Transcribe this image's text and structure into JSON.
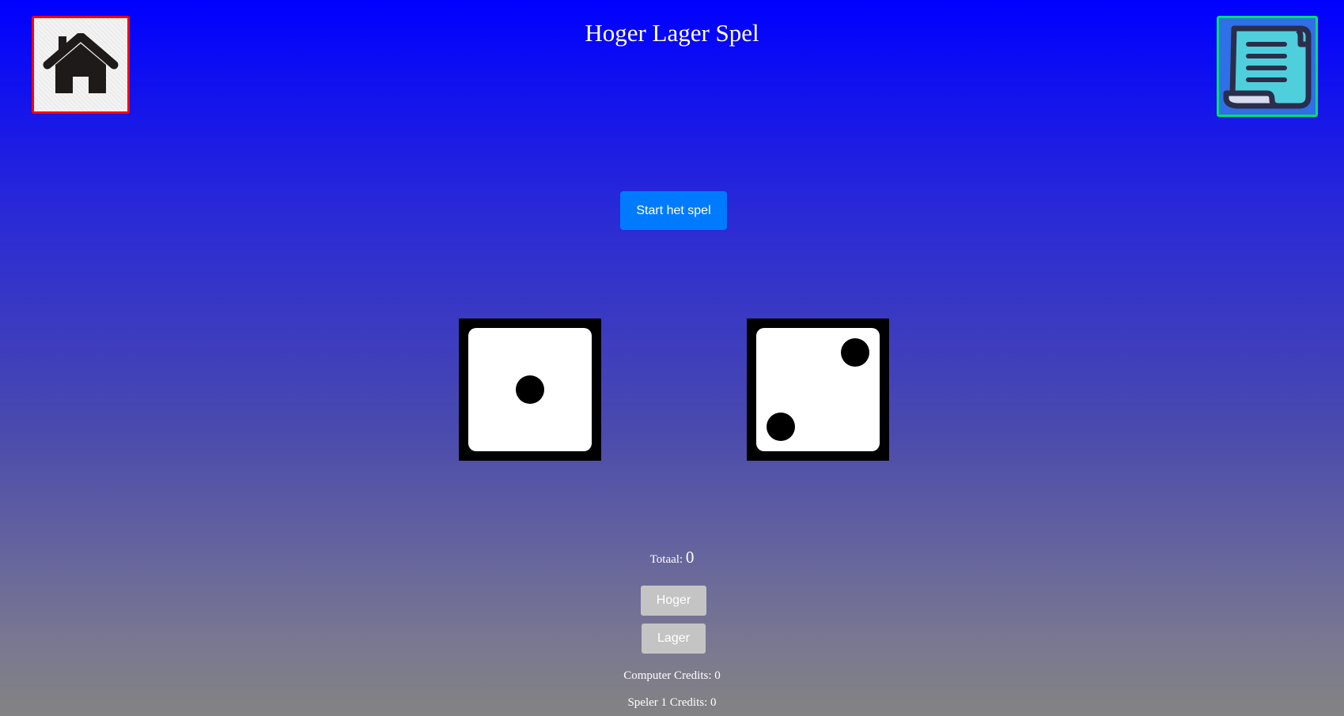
{
  "header": {
    "title": "Hoger Lager Spel"
  },
  "nav": {
    "home_icon": "home-icon",
    "rules_icon": "scroll-icon"
  },
  "game": {
    "start_label": "Start het spel",
    "dice": [
      1,
      2
    ],
    "total_label": "Totaal: ",
    "total_value": "0",
    "higher_label": "Hoger",
    "lower_label": "Lager",
    "computer_credits": "Computer Credits: 0",
    "player_credits": "Speler 1 Credits: 0"
  },
  "colors": {
    "home_border": "#ff0000",
    "rules_border": "#00e070",
    "start_button": "#007bff",
    "disabled_button": "#c4c4c4"
  }
}
